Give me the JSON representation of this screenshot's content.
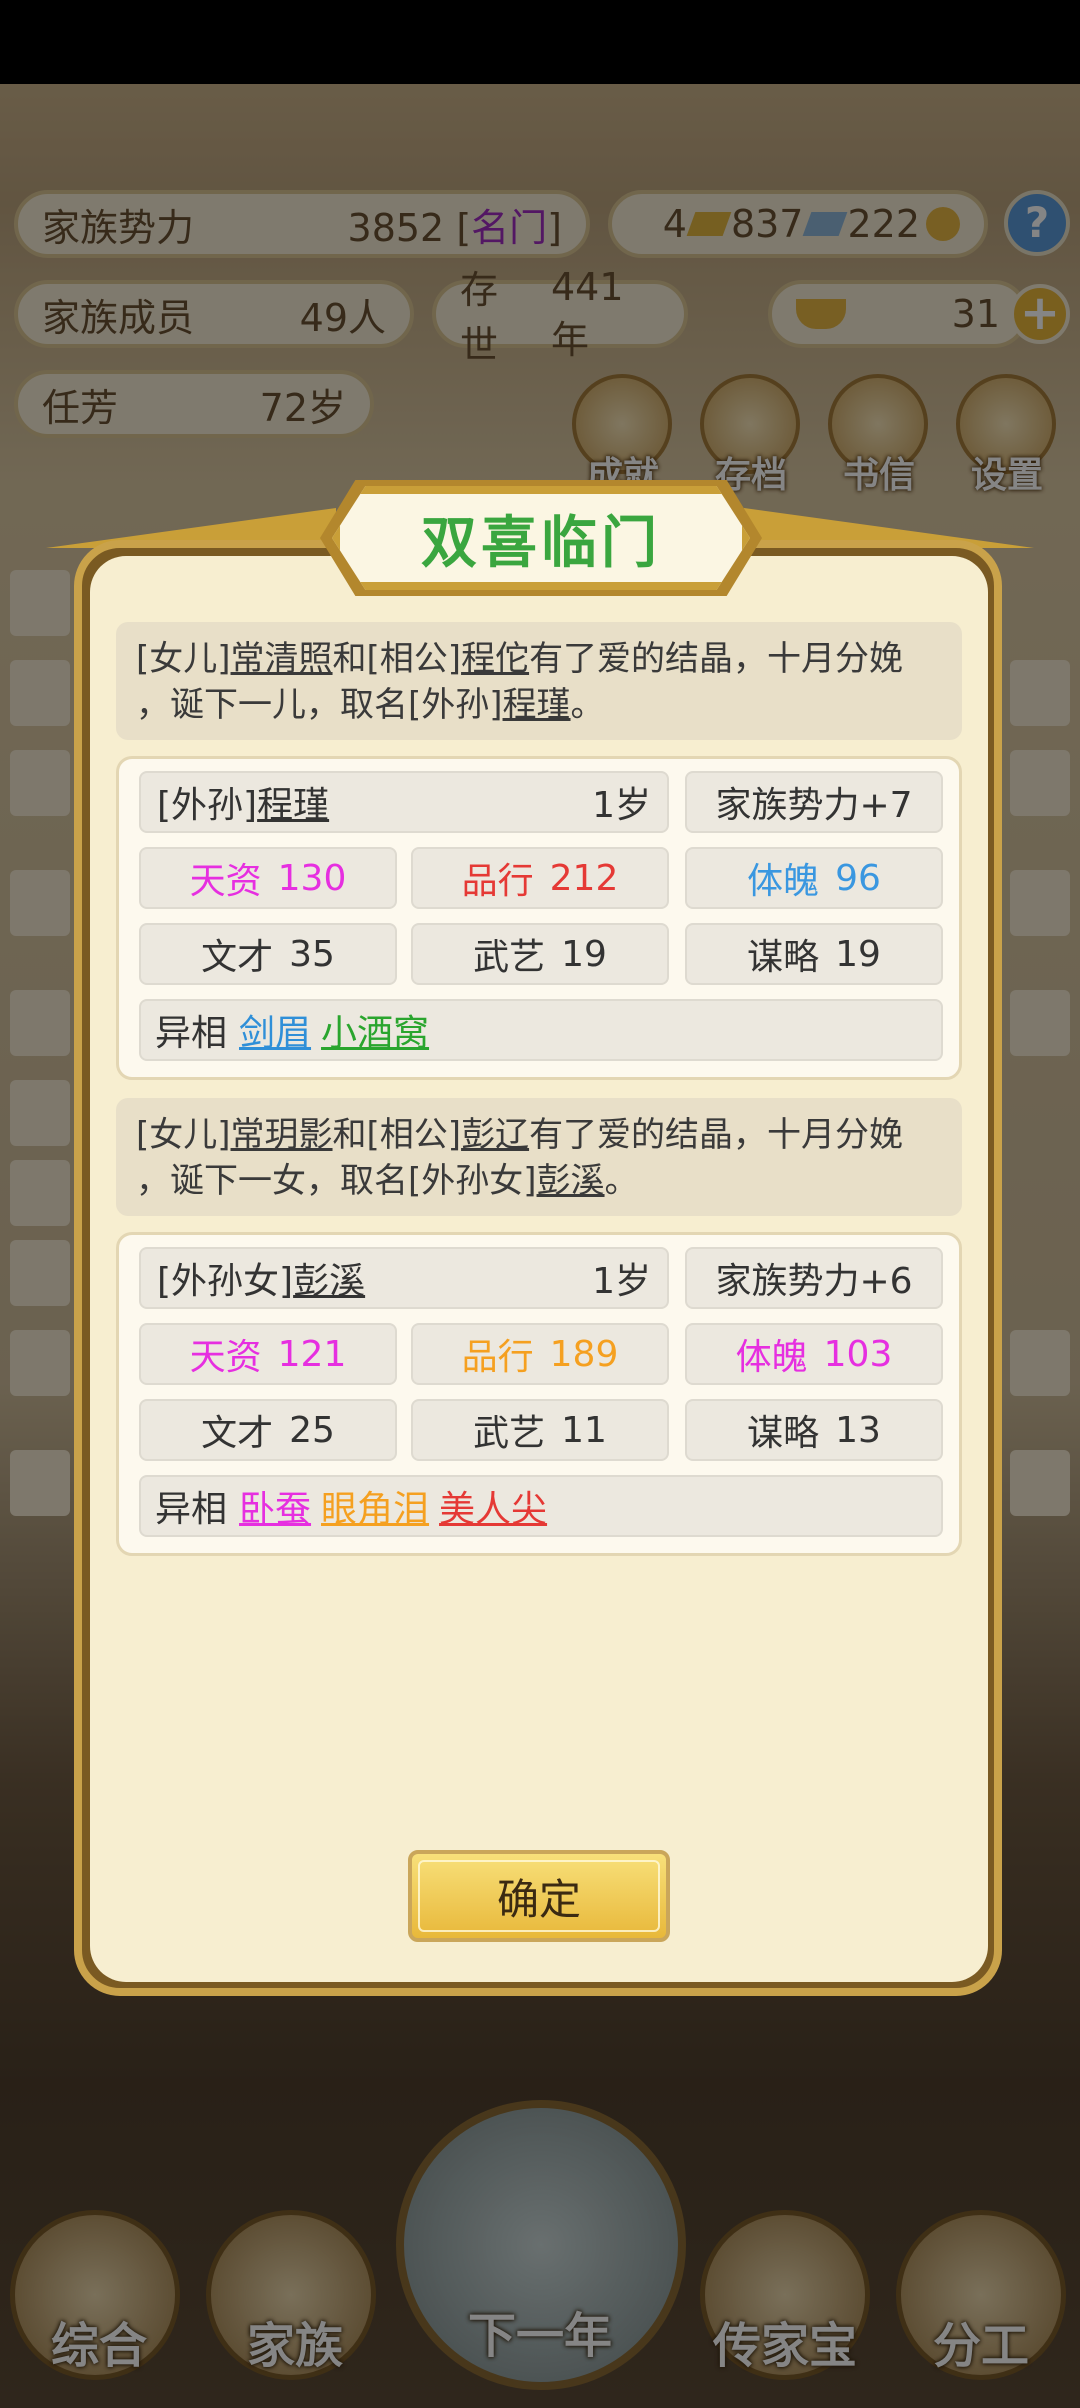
{
  "hud": {
    "clan_power_label": "家族势力",
    "clan_power_value": "3852 [",
    "clan_power_rank": "名门",
    "clan_power_close": "]",
    "currency1": "4",
    "currency2": "837",
    "currency3": "222",
    "members_label": "家族成员",
    "members_value": "49人",
    "alive_label": "存世",
    "alive_value": "441年",
    "gold_value": "31",
    "leader_name": "任芳",
    "leader_age": "72岁",
    "help_symbol": "?",
    "add_symbol": "+"
  },
  "top_buttons": [
    {
      "label": "成就"
    },
    {
      "label": "存档"
    },
    {
      "label": "书信"
    },
    {
      "label": "设置"
    }
  ],
  "bottom_nav": [
    {
      "label": "综合"
    },
    {
      "label": "家族"
    },
    {
      "label": "下一年"
    },
    {
      "label": "传家宝"
    },
    {
      "label": "分工"
    }
  ],
  "modal": {
    "title": "双喜临门",
    "events": [
      {
        "pre1": "[女儿]",
        "mother": "常清照",
        "mid1": "和[相公]",
        "father": "程佗",
        "mid2": "有了爱的结晶，十月分娩",
        "line2a": "，诞下一儿，取名[外孙]",
        "child": "程瑾",
        "end": "。"
      },
      {
        "pre1": "[女儿]",
        "mother": "常玥影",
        "mid1": "和[相公]",
        "father": "彭辽",
        "mid2": "有了爱的结晶，十月分娩",
        "line2a": "，诞下一女，取名[外孙女]",
        "child": "彭溪",
        "end": "。"
      }
    ],
    "children": [
      {
        "relation": "[外孙]",
        "name": "程瑾",
        "age": "1岁",
        "power": "家族势力+7",
        "talent_label": "天资",
        "talent_value": "130",
        "talent_color": "#e62fe0",
        "conduct_label": "品行",
        "conduct_value": "212",
        "conduct_color": "#e53935",
        "physique_label": "体魄",
        "physique_value": "96",
        "physique_color": "#3a97e0",
        "literary_label": "文才",
        "literary_value": "35",
        "martial_label": "武艺",
        "martial_value": "19",
        "strategy_label": "谋略",
        "strategy_value": "19",
        "traits_label": "异相",
        "traits": [
          {
            "text": "剑眉",
            "color": "#2f8fd8"
          },
          {
            "text": "小酒窝",
            "color": "#2aa52e"
          }
        ]
      },
      {
        "relation": "[外孙女]",
        "name": "彭溪",
        "age": "1岁",
        "power": "家族势力+6",
        "talent_label": "天资",
        "talent_value": "121",
        "talent_color": "#e62fe0",
        "conduct_label": "品行",
        "conduct_value": "189",
        "conduct_color": "#f5a020",
        "physique_label": "体魄",
        "physique_value": "103",
        "physique_color": "#e62fe0",
        "literary_label": "文才",
        "literary_value": "25",
        "martial_label": "武艺",
        "martial_value": "11",
        "strategy_label": "谋略",
        "strategy_value": "13",
        "traits_label": "异相",
        "traits": [
          {
            "text": "卧蚕",
            "color": "#e62fe0"
          },
          {
            "text": "眼角泪",
            "color": "#f5a020"
          },
          {
            "text": "美人尖",
            "color": "#e53935"
          }
        ]
      }
    ],
    "confirm_label": "确定"
  }
}
